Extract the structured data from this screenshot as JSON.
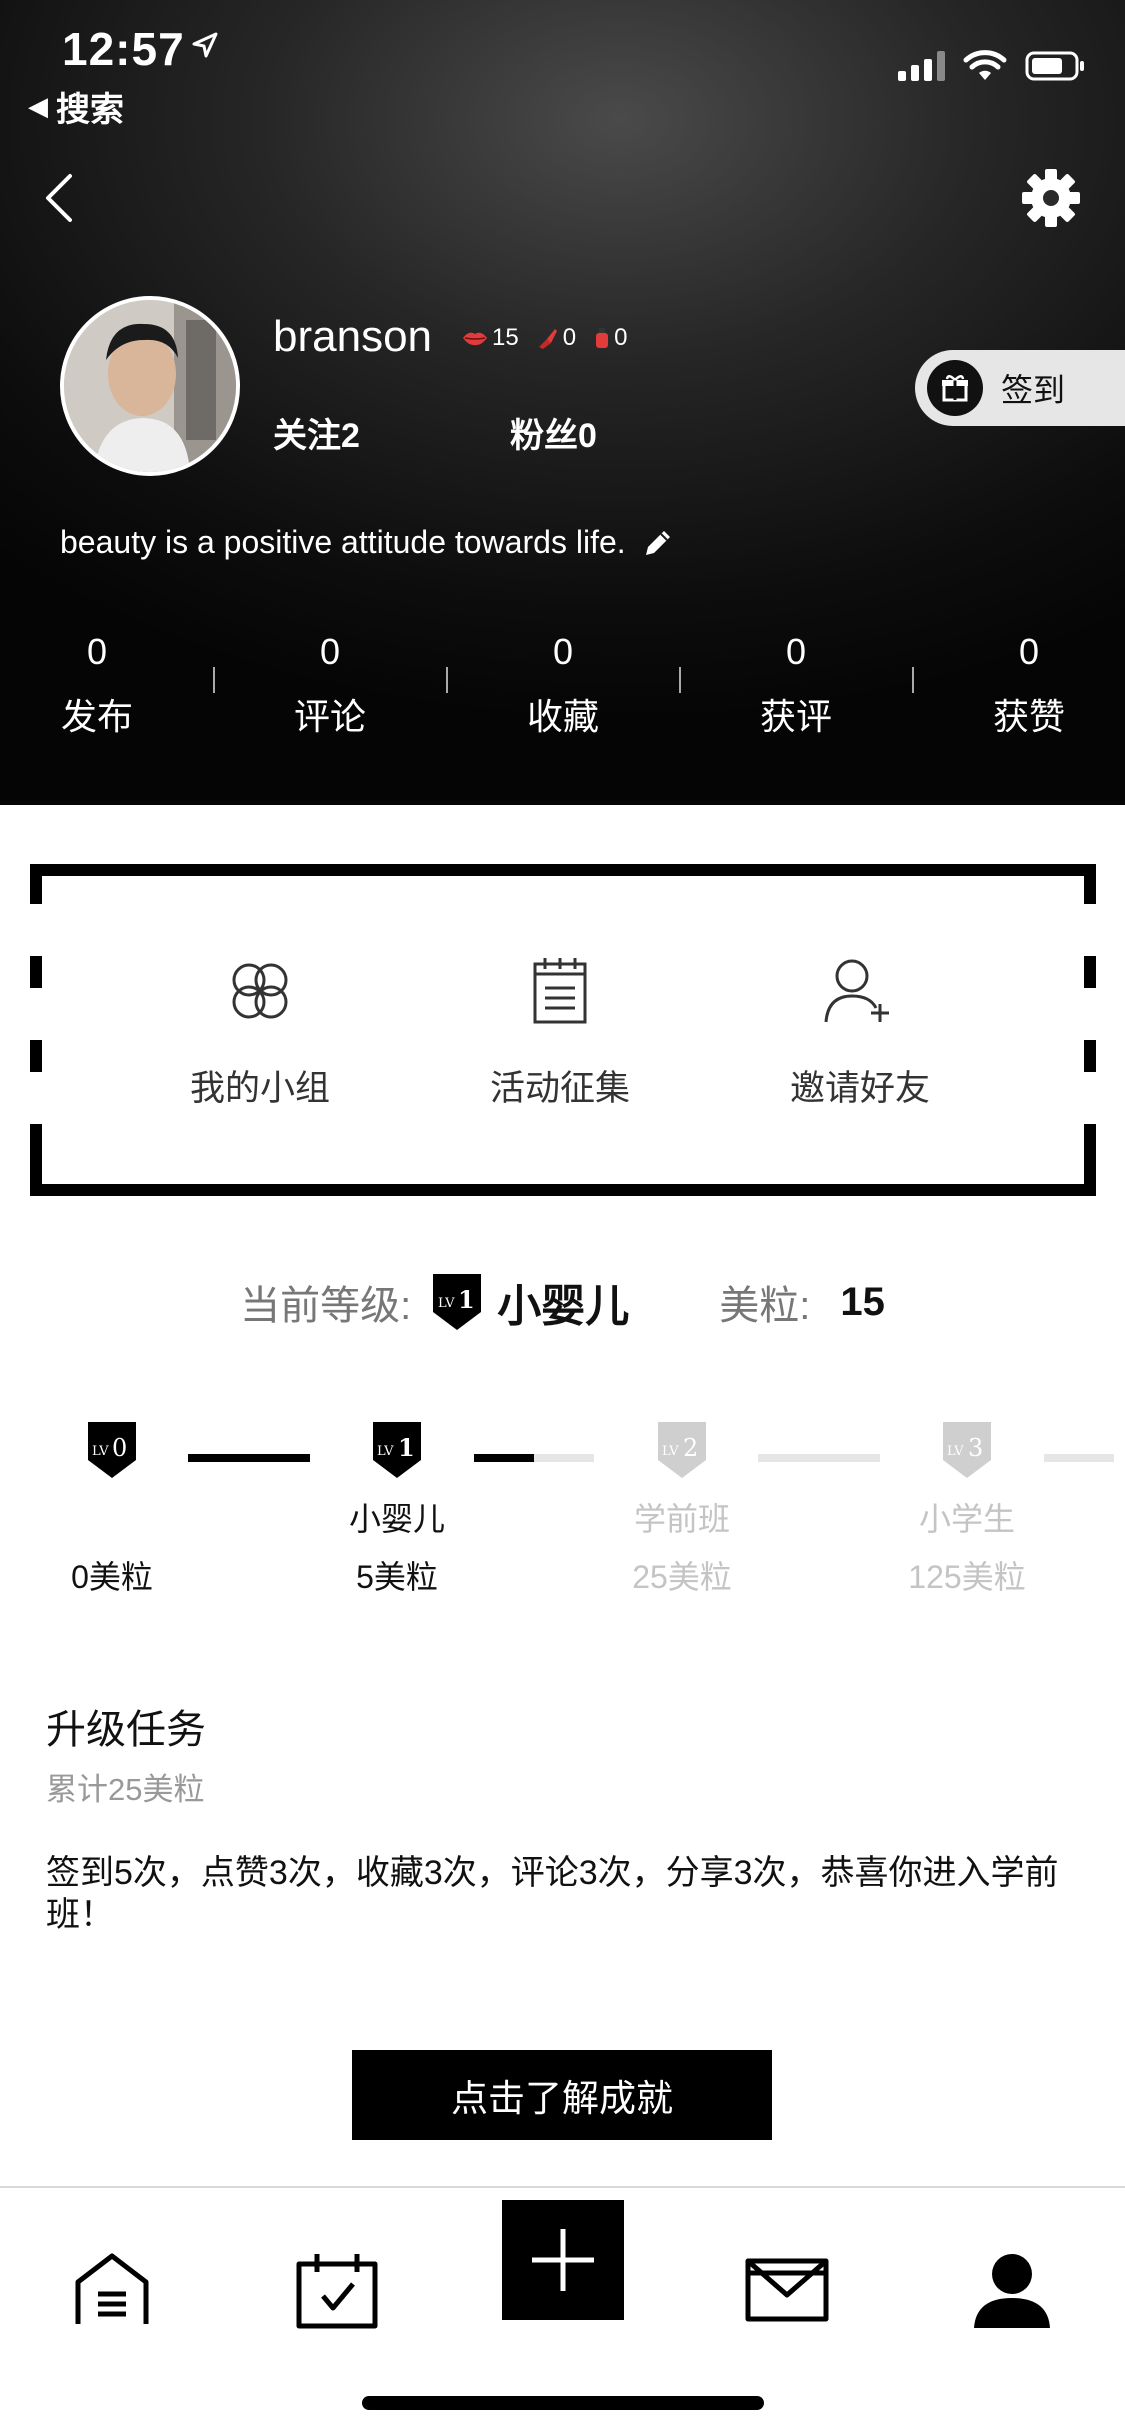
{
  "status_bar": {
    "time": "12:57",
    "back_app": "搜索"
  },
  "profile": {
    "username": "branson",
    "badges": [
      {
        "icon": "lips-icon",
        "count": "15"
      },
      {
        "icon": "lipstick-icon",
        "count": "0"
      },
      {
        "icon": "bottle-icon",
        "count": "0"
      }
    ],
    "follow": "关注2",
    "fans": "粉丝0",
    "checkin_label": "签到",
    "bio": "beauty is a positive attitude towards life."
  },
  "stats": [
    {
      "value": "0",
      "label": "发布"
    },
    {
      "value": "0",
      "label": "评论"
    },
    {
      "value": "0",
      "label": "收藏"
    },
    {
      "value": "0",
      "label": "获评"
    },
    {
      "value": "0",
      "label": "获赞"
    }
  ],
  "quick_actions": [
    {
      "label": "我的小组",
      "icon": "clover-icon"
    },
    {
      "label": "活动征集",
      "icon": "notepad-icon"
    },
    {
      "label": "邀请好友",
      "icon": "add-user-icon"
    }
  ],
  "level": {
    "current_label": "当前等级:",
    "current_badge": "LV1",
    "current_name": "小婴儿",
    "points_label": "美粒:",
    "points_value": "15"
  },
  "level_track": [
    {
      "badge": "LV0",
      "name": "",
      "points": "0美粒",
      "achieved": true
    },
    {
      "badge": "LV1",
      "name": "小婴儿",
      "points": "5美粒",
      "achieved": true
    },
    {
      "badge": "LV2",
      "name": "学前班",
      "points": "25美粒",
      "achieved": false
    },
    {
      "badge": "LV3",
      "name": "小学生",
      "points": "125美粒",
      "achieved": false
    }
  ],
  "level_progress_to_next": 0.5,
  "task": {
    "title": "升级任务",
    "subtitle": "累计25美粒",
    "description": "签到5次，点赞3次，收藏3次，评论3次，分享3次，恭喜你进入学前班！"
  },
  "cta_label": "点击了解成就",
  "tabbar": [
    {
      "icon": "home-icon"
    },
    {
      "icon": "calendar-check-icon"
    },
    {
      "icon": "plus-icon"
    },
    {
      "icon": "mail-icon"
    },
    {
      "icon": "profile-icon",
      "active": true
    }
  ],
  "colors": {
    "header_bg": "#0d0d0d",
    "accent": "#000000",
    "muted": "#999999",
    "badge_red": "#e23b3b"
  }
}
